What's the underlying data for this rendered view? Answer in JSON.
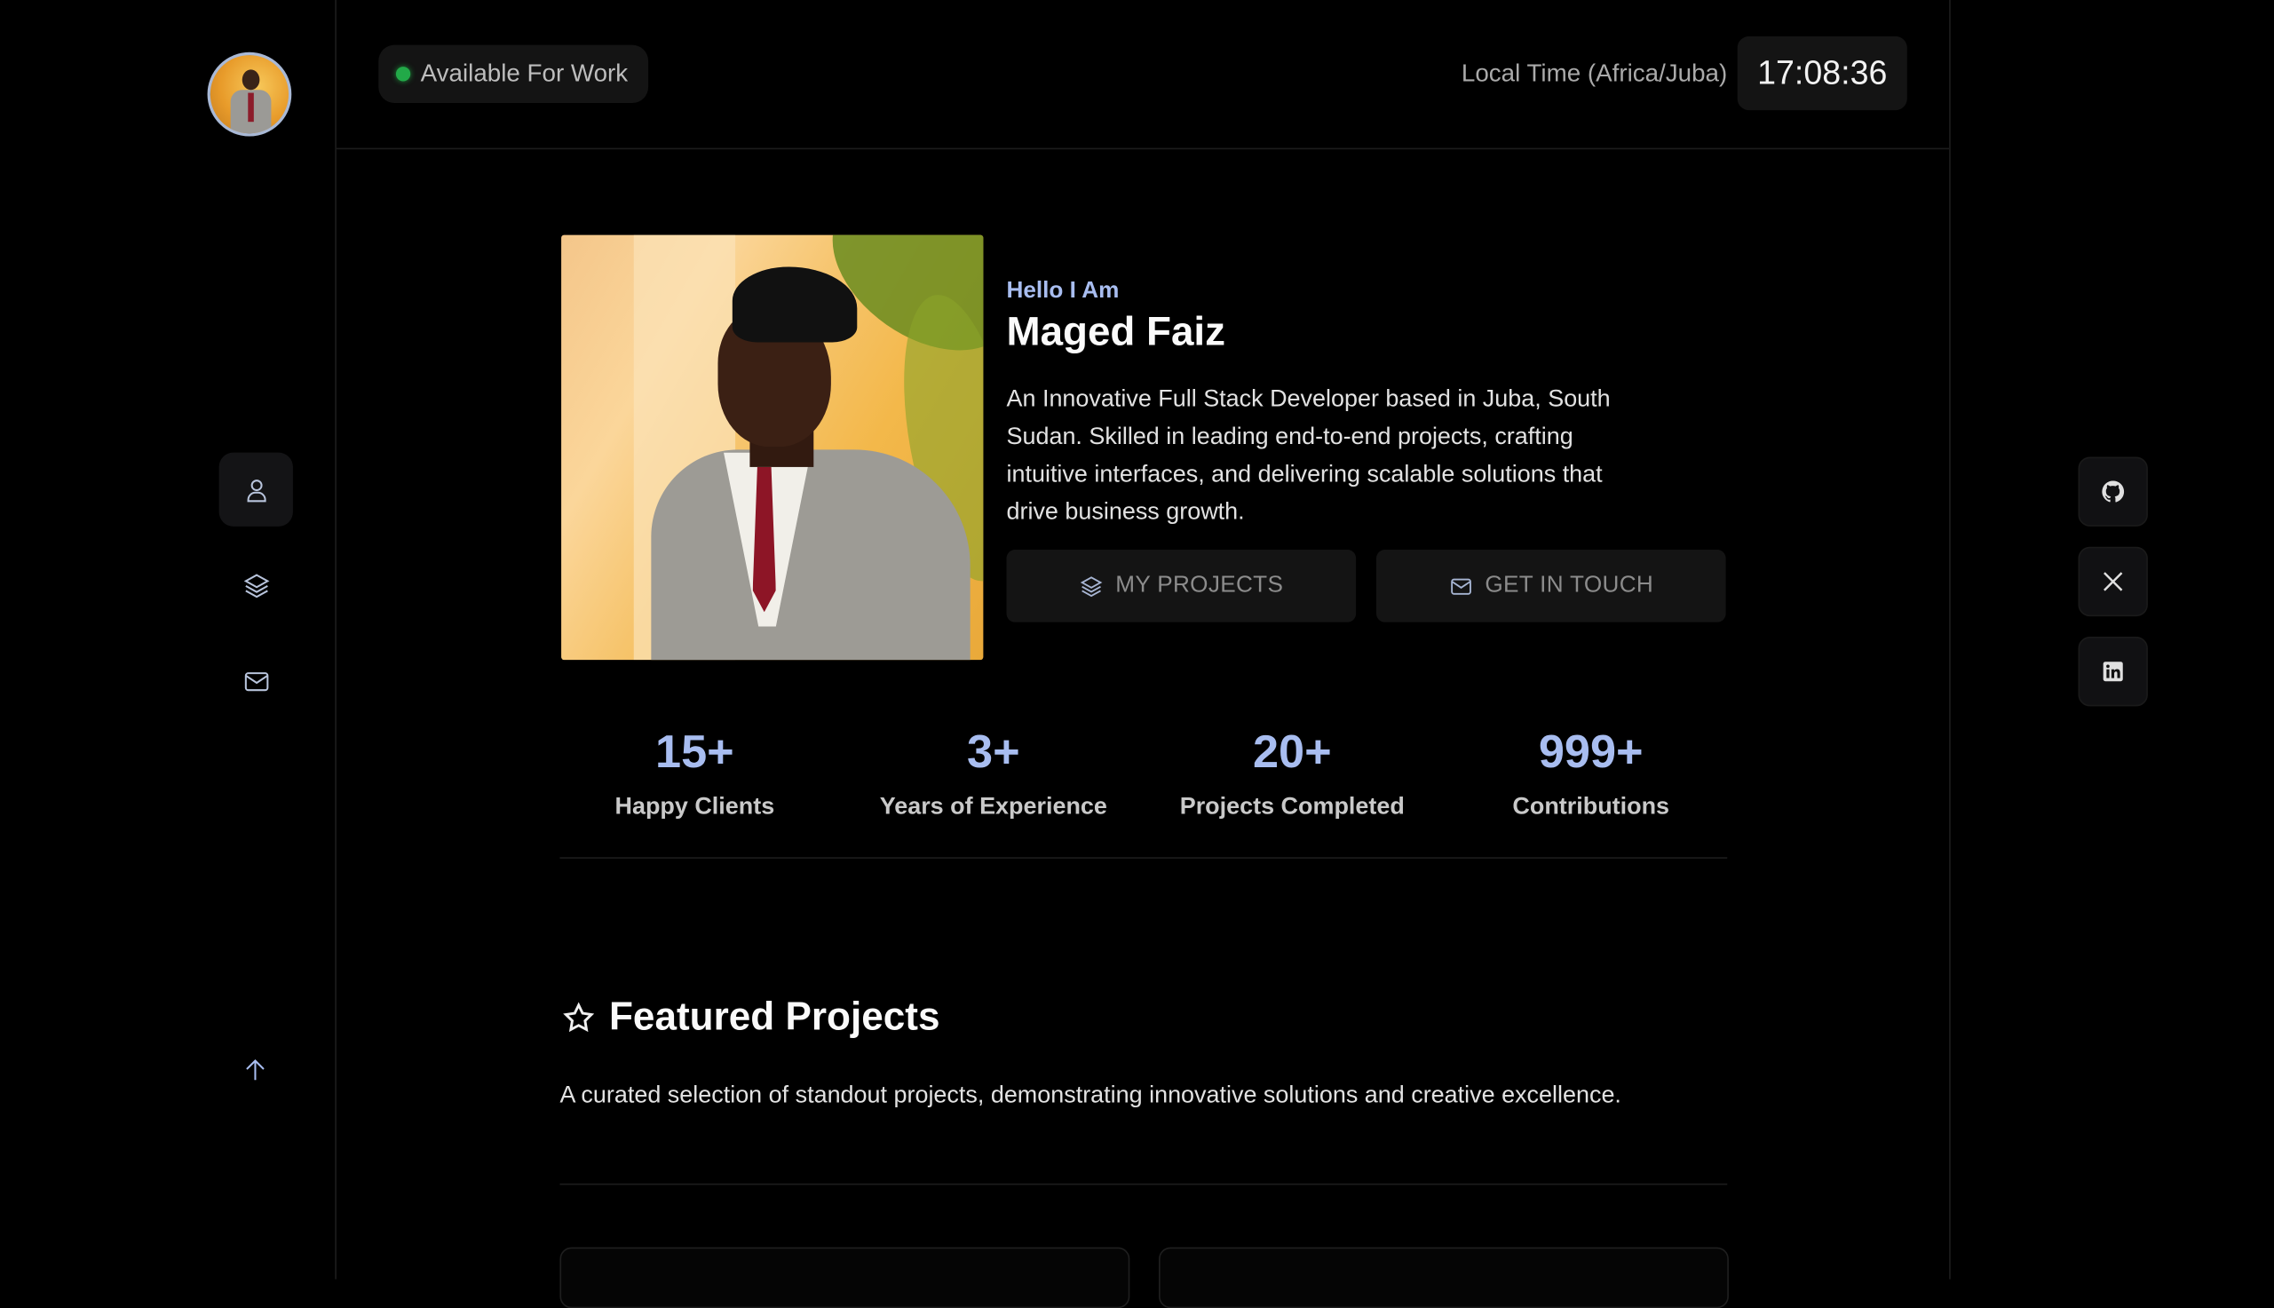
{
  "header": {
    "status_label": "Available For Work",
    "status_color": "#22a948",
    "local_time_label": "Local Time (Africa/Juba)",
    "clock_value": "17:08:36"
  },
  "sidebar": {
    "items": [
      {
        "name": "about",
        "icon": "user-icon",
        "active": true
      },
      {
        "name": "projects",
        "icon": "layers-icon",
        "active": false
      },
      {
        "name": "contact",
        "icon": "mail-icon",
        "active": false
      }
    ],
    "back_to_top_icon": "arrow-up-icon"
  },
  "hero": {
    "greeting": "Hello I Am",
    "name": "Maged Faiz",
    "bio": "An Innovative Full Stack Developer based in Juba, South Sudan. Skilled in leading end-to-end projects, crafting intuitive interfaces, and delivering scalable solutions that drive business growth.",
    "buttons": {
      "projects_label": "MY PROJECTS",
      "contact_label": "GET IN TOUCH"
    }
  },
  "stats": [
    {
      "value": "15+",
      "label": "Happy Clients"
    },
    {
      "value": "3+",
      "label": "Years of Experience"
    },
    {
      "value": "20+",
      "label": "Projects Completed"
    },
    {
      "value": "999+",
      "label": "Contributions"
    }
  ],
  "featured": {
    "title": "Featured Projects",
    "description": "A curated selection of standout projects, demonstrating innovative solutions and creative excellence."
  },
  "social": [
    {
      "name": "github",
      "icon": "github-icon"
    },
    {
      "name": "x",
      "icon": "x-icon"
    },
    {
      "name": "linkedin",
      "icon": "linkedin-icon"
    }
  ],
  "colors": {
    "accent": "#a8bdf0",
    "background": "#000000",
    "surface": "#141414"
  }
}
